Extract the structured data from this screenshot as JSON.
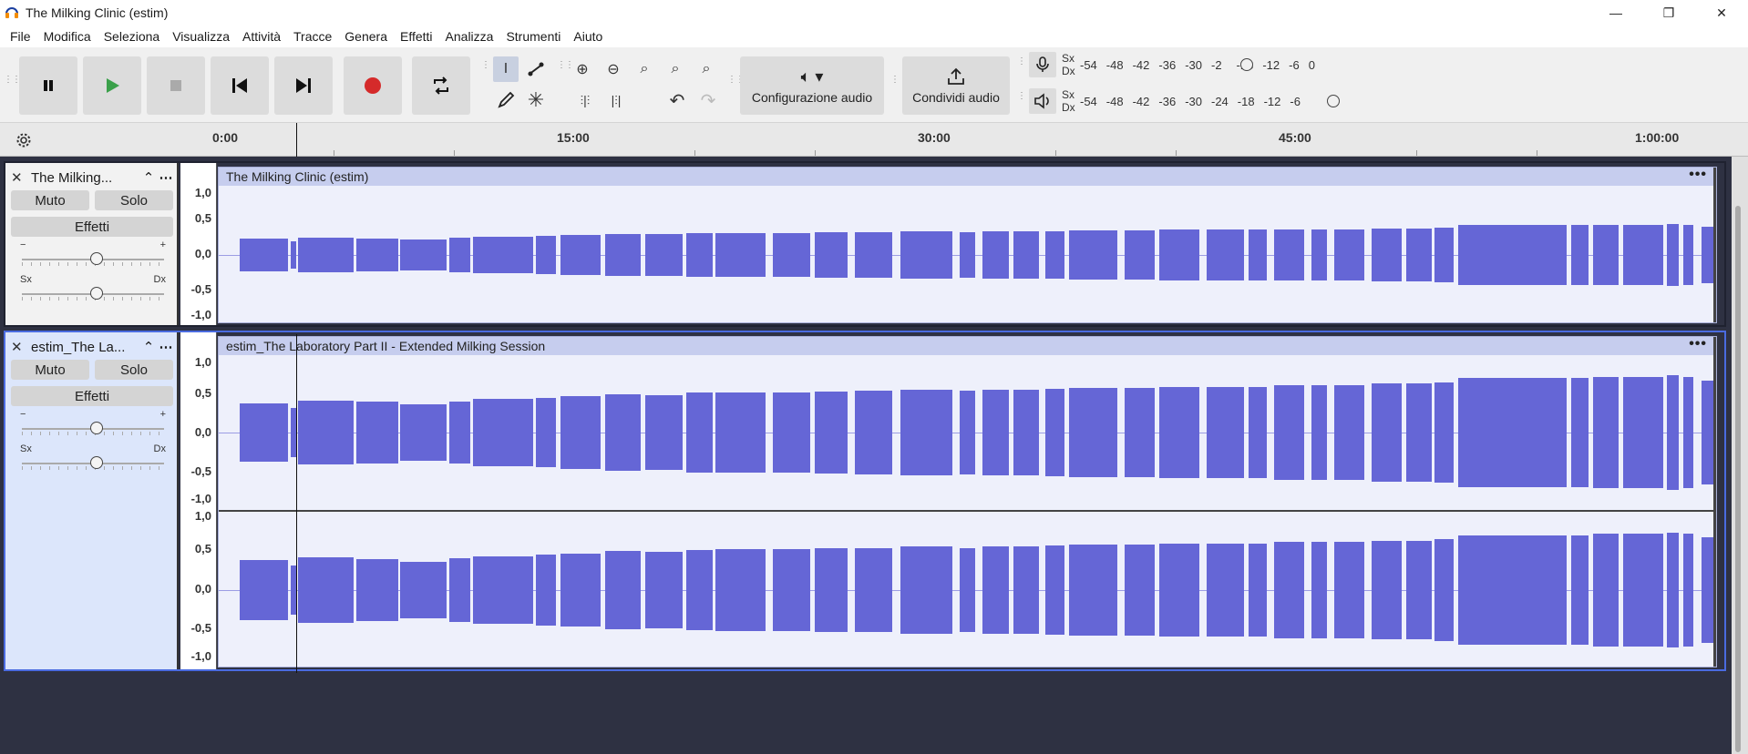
{
  "window": {
    "title": "The Milking Clinic (estim)",
    "controls": {
      "minimize": "—",
      "maximize": "❐",
      "close": "✕"
    }
  },
  "menu": [
    "File",
    "Modifica",
    "Seleziona",
    "Visualizza",
    "Attività",
    "Tracce",
    "Genera",
    "Effetti",
    "Analizza",
    "Strumenti",
    "Aiuto"
  ],
  "toolbar": {
    "transport": [
      "pause-icon",
      "play-icon",
      "stop-icon",
      "skip-start-icon",
      "skip-end-icon",
      "record-icon",
      "loop-icon"
    ],
    "audio_setup_label": "Configurazione audio",
    "share_label": "Condividi audio"
  },
  "meters": {
    "record": {
      "left": "Sx",
      "right": "Dx",
      "scale": [
        "-54",
        "-48",
        "-42",
        "-36",
        "-30",
        "-2",
        "-18",
        "-12",
        "-6",
        "0"
      ]
    },
    "playback": {
      "left": "Sx",
      "right": "Dx",
      "scale": [
        "-54",
        "-48",
        "-42",
        "-36",
        "-30",
        "-24",
        "-18",
        "-12",
        "-6"
      ]
    }
  },
  "ruler": {
    "labels": [
      "0:00",
      "15:00",
      "30:00",
      "45:00",
      "1:00:00"
    ]
  },
  "tracks": [
    {
      "name": "The Milking...",
      "clip_title": "The Milking Clinic (estim)",
      "mute_label": "Muto",
      "solo_label": "Solo",
      "effects_label": "Effetti",
      "pan_left": "Sx",
      "pan_right": "Dx",
      "scale": [
        "1,0",
        "0,5",
        "0,0",
        "-0,5",
        "-1,0"
      ],
      "selected": false,
      "channels": 1
    },
    {
      "name": "estim_The La...",
      "clip_title": "estim_The Laboratory Part II - Extended Milking Session",
      "mute_label": "Muto",
      "solo_label": "Solo",
      "effects_label": "Effetti",
      "pan_left": "Sx",
      "pan_right": "Dx",
      "scale": [
        "1,0",
        "0,5",
        "0,0",
        "-0,5",
        "-1,0"
      ],
      "selected": true,
      "channels": 2
    }
  ],
  "colors": {
    "waveform": "#6566d6",
    "clip_bg": "#eef0fb",
    "clip_header": "#c6cdee",
    "selected_border": "#4a6be0",
    "background": "#2e3142"
  }
}
